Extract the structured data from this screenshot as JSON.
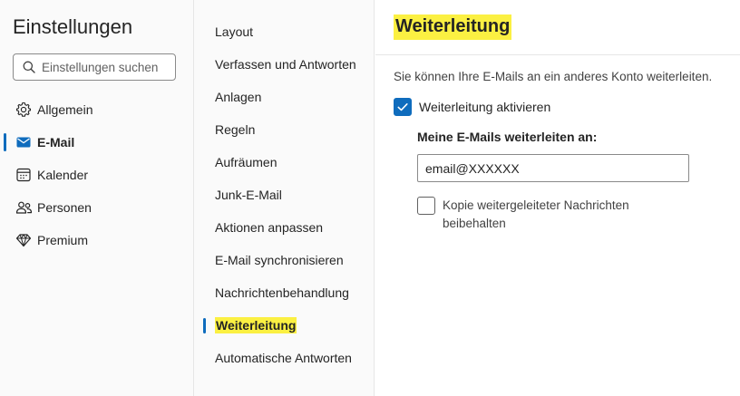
{
  "app": {
    "title": "Einstellungen"
  },
  "search": {
    "placeholder": "Einstellungen suchen"
  },
  "categories": [
    {
      "label": "Allgemein",
      "icon": "gear-icon"
    },
    {
      "label": "E-Mail",
      "icon": "mail-icon",
      "active": true
    },
    {
      "label": "Kalender",
      "icon": "calendar-icon"
    },
    {
      "label": "Personen",
      "icon": "people-icon"
    },
    {
      "label": "Premium",
      "icon": "diamond-icon"
    }
  ],
  "subnav": [
    {
      "label": "Layout"
    },
    {
      "label": "Verfassen und Antworten"
    },
    {
      "label": "Anlagen"
    },
    {
      "label": "Regeln"
    },
    {
      "label": "Aufräumen"
    },
    {
      "label": "Junk-E-Mail"
    },
    {
      "label": "Aktionen anpassen"
    },
    {
      "label": "E-Mail synchronisieren"
    },
    {
      "label": "Nachrichtenbehandlung"
    },
    {
      "label": "Weiterleitung",
      "active": true
    },
    {
      "label": "Automatische Antworten"
    }
  ],
  "forwarding": {
    "title": "Weiterleitung",
    "description": "Sie können Ihre E-Mails an ein anderes Konto weiterleiten.",
    "enable_label": "Weiterleitung aktivieren",
    "enable_checked": true,
    "target_label": "Meine E-Mails weiterleiten an:",
    "target_value": "email@XXXXXX",
    "keep_copy_label": "Kopie weitergeleiteter Nachrichten beibehalten",
    "keep_copy_checked": false
  },
  "colors": {
    "accent": "#0f6cbd",
    "highlight": "#fbf042",
    "pane_background": "#fafafa"
  }
}
